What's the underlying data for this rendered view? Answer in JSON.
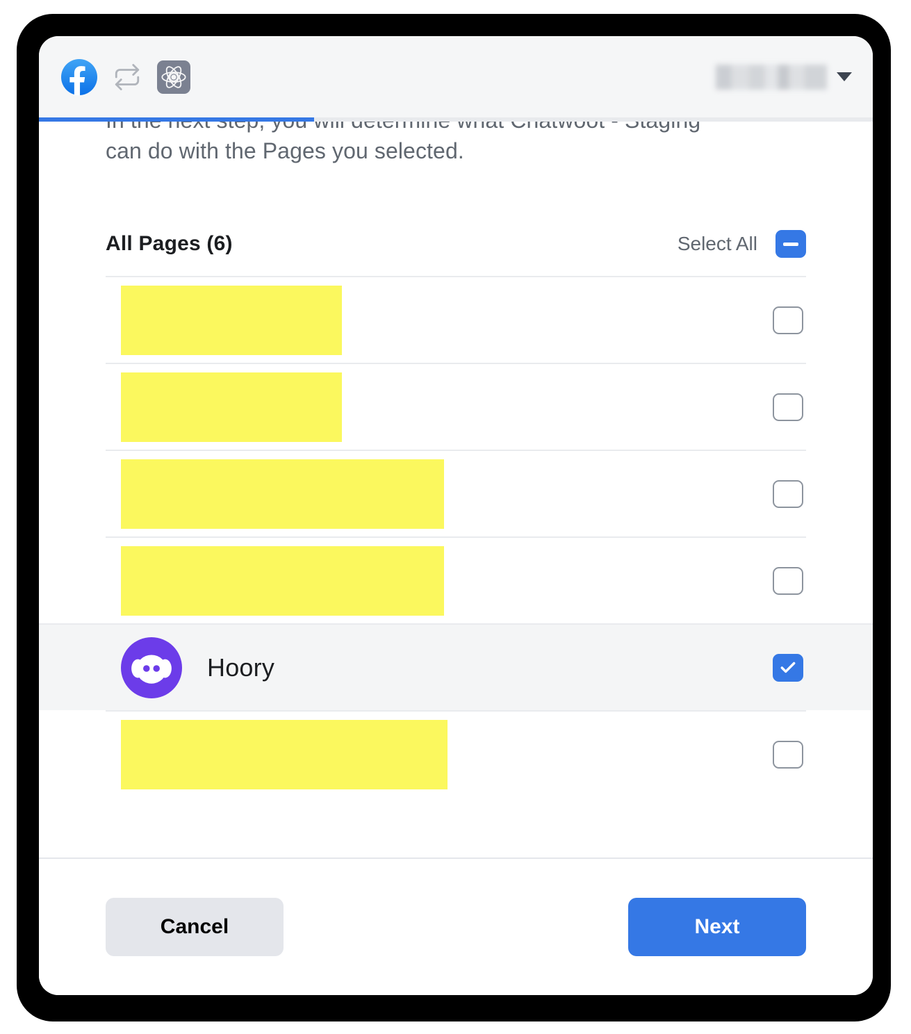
{
  "window": {
    "header": {
      "icons": [
        {
          "name": "facebook-logo-icon",
          "label": "Facebook"
        },
        {
          "name": "loop-repeat-icon",
          "label": "Repeat"
        },
        {
          "name": "react-atom-icon",
          "label": "React"
        }
      ],
      "account_menu": {
        "name_redacted": "",
        "caret": "▼"
      }
    },
    "progress": {
      "percent": 33,
      "fill_color": "#3578e5",
      "track_color": "#e8eaed"
    }
  },
  "body": {
    "intro_line_1": "In the next step, you will determine what Chatwoot - Staging",
    "intro_line_2": "can do with the Pages you selected.",
    "list_header": {
      "title": "All Pages (6)",
      "select_all_label": "Select All",
      "select_all_state": "indeterminate"
    },
    "rows": [
      {
        "name_redacted": "",
        "redaction_width": 318,
        "checked": false,
        "has_avatar": false
      },
      {
        "name_redacted": "",
        "redaction_width": 318,
        "checked": false,
        "has_avatar": false
      },
      {
        "name_redacted": "",
        "redaction_width": 465,
        "checked": false,
        "has_avatar": false
      },
      {
        "name_redacted": "",
        "redaction_width": 465,
        "checked": false,
        "has_avatar": false
      },
      {
        "name": "Hoory",
        "checked": true,
        "has_avatar": true,
        "avatar_color": "#6c3ce9"
      },
      {
        "name_redacted": "",
        "redaction_width": 470,
        "checked": false,
        "has_avatar": false
      }
    ]
  },
  "footer": {
    "cancel_label": "Cancel",
    "next_label": "Next"
  },
  "colors": {
    "accent_blue": "#3578e5",
    "redaction_yellow": "#fbf85e",
    "header_bg": "#f5f6f7",
    "selected_row_bg": "#f4f5f6"
  }
}
